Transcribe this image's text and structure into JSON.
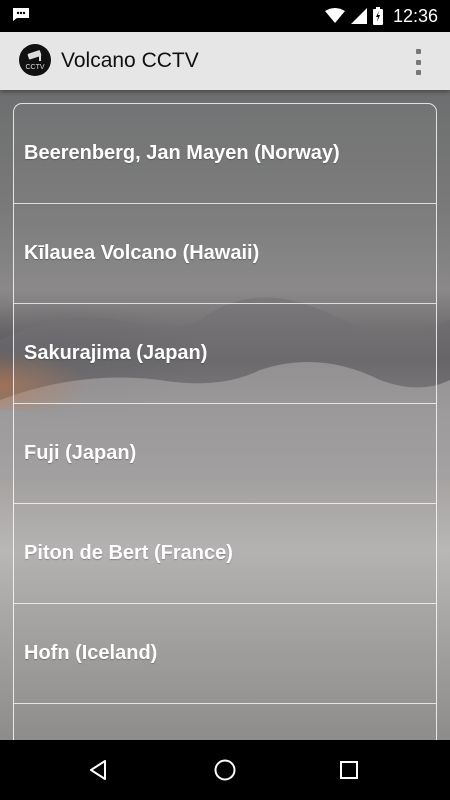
{
  "status_bar": {
    "time": "12:36",
    "icons": [
      "chat-notification-icon",
      "wifi-icon",
      "signal-icon",
      "battery-icon"
    ]
  },
  "app_bar": {
    "title": "Volcano CCTV",
    "logo_text": "CCTV",
    "logo_icon": "cctv-camera-logo",
    "menu_icon": "overflow-menu-icon"
  },
  "volcanoes": [
    {
      "label": "Beerenberg, Jan Mayen (Norway)"
    },
    {
      "label": "Kīlauea Volcano (Hawaii)"
    },
    {
      "label": "Sakurajima (Japan)"
    },
    {
      "label": "Fuji (Japan)"
    },
    {
      "label": "Piton de Bert (France)"
    },
    {
      "label": "Hofn (Iceland)"
    },
    {
      "label": ""
    }
  ],
  "nav_bar": {
    "icons": [
      "back-icon",
      "home-icon",
      "recents-icon"
    ]
  },
  "colors": {
    "app_bar_bg": "#e6e6e6",
    "status_bar_bg": "#000000",
    "list_text": "#ffffff",
    "divider": "#ffffff"
  }
}
